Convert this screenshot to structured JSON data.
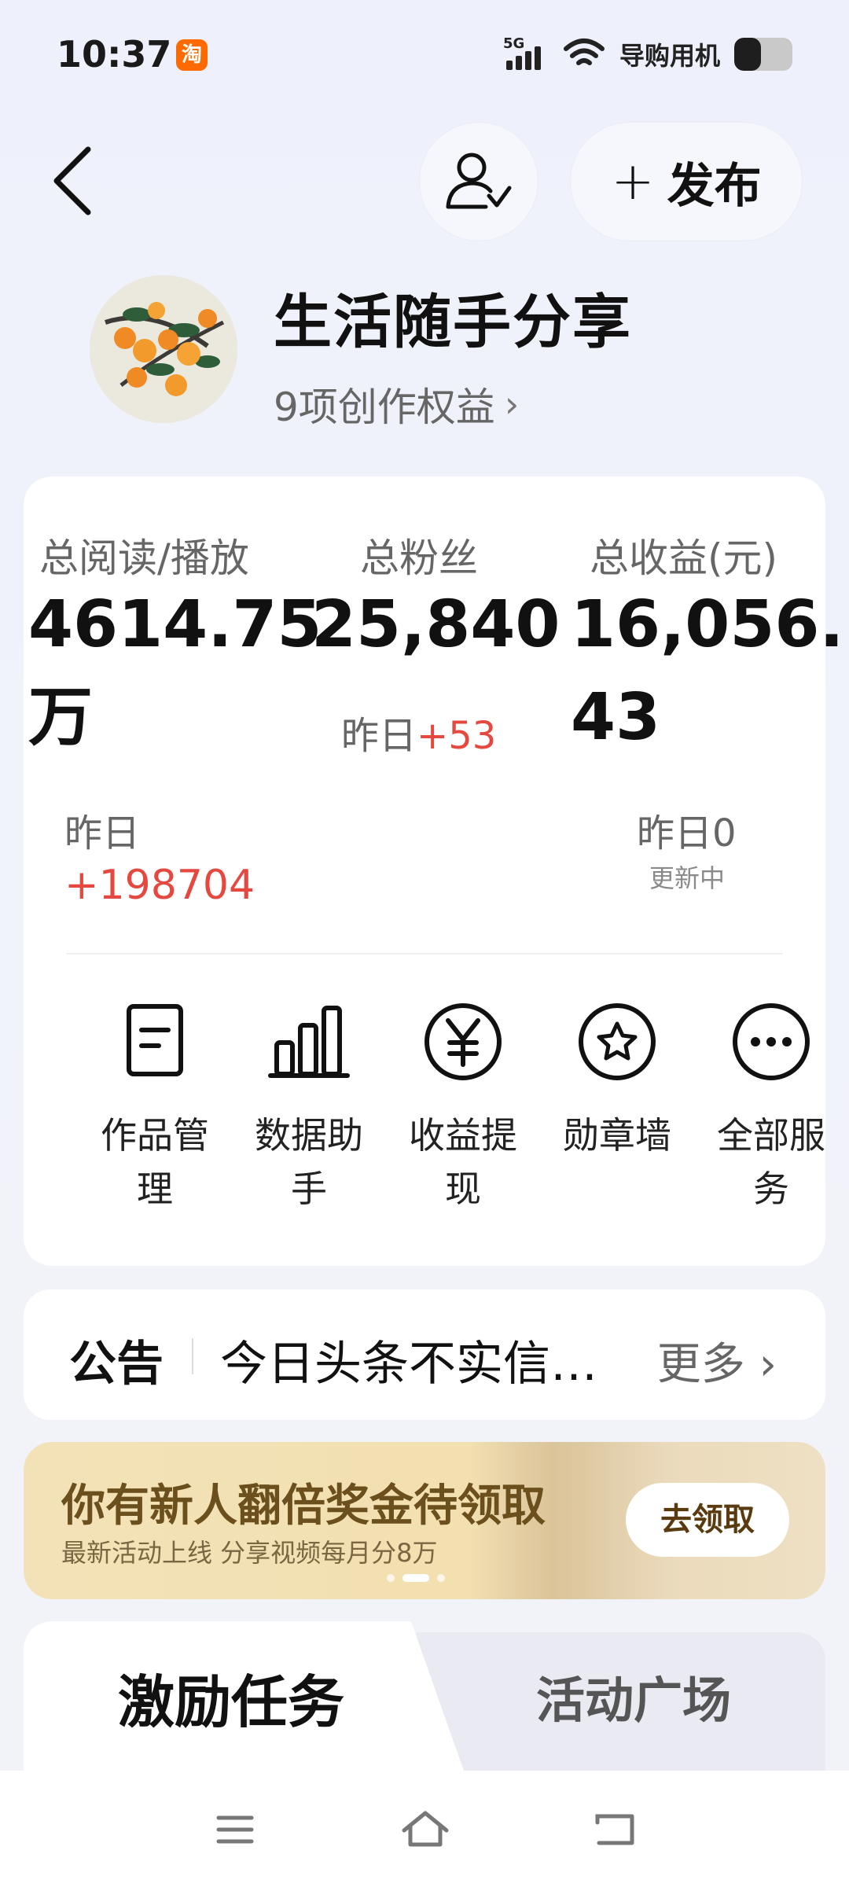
{
  "status_bar": {
    "time": "10:37",
    "app_badge": "淘",
    "network": "5G",
    "carrier": "导购用机"
  },
  "header": {
    "publish_label": "发布"
  },
  "profile": {
    "name": "生活随手分享",
    "rights": "9项创作权益"
  },
  "stats": {
    "reads": {
      "label": "总阅读/播放",
      "value_line1": "4614.75",
      "value_line2": "万",
      "yday_label": "昨日",
      "yday_value": "+198704"
    },
    "fans": {
      "label": "总粉丝",
      "value": "25,840",
      "yday_label": "昨日",
      "yday_value": "+53"
    },
    "income": {
      "label": "总收益(元)",
      "value_line1": "16,056.",
      "value_line2": "43",
      "yday": "昨日0",
      "updating": "更新中"
    }
  },
  "services": [
    {
      "label": "作品管理",
      "icon": "document-icon"
    },
    {
      "label": "数据助手",
      "icon": "bar-chart-icon"
    },
    {
      "label": "收益提现",
      "icon": "yuan-icon"
    },
    {
      "label": "勋章墙",
      "icon": "medal-icon"
    },
    {
      "label": "全部服务",
      "icon": "more-icon"
    }
  ],
  "notice": {
    "title": "公告",
    "text": "今日头条不实信…",
    "more": "更多"
  },
  "banner": {
    "title": "你有新人翻倍奖金待领取",
    "subtitle": "最新活动上线 分享视频每月分8万",
    "button": "去领取"
  },
  "tabs": {
    "active": "激励任务",
    "inactive": "活动广场"
  }
}
